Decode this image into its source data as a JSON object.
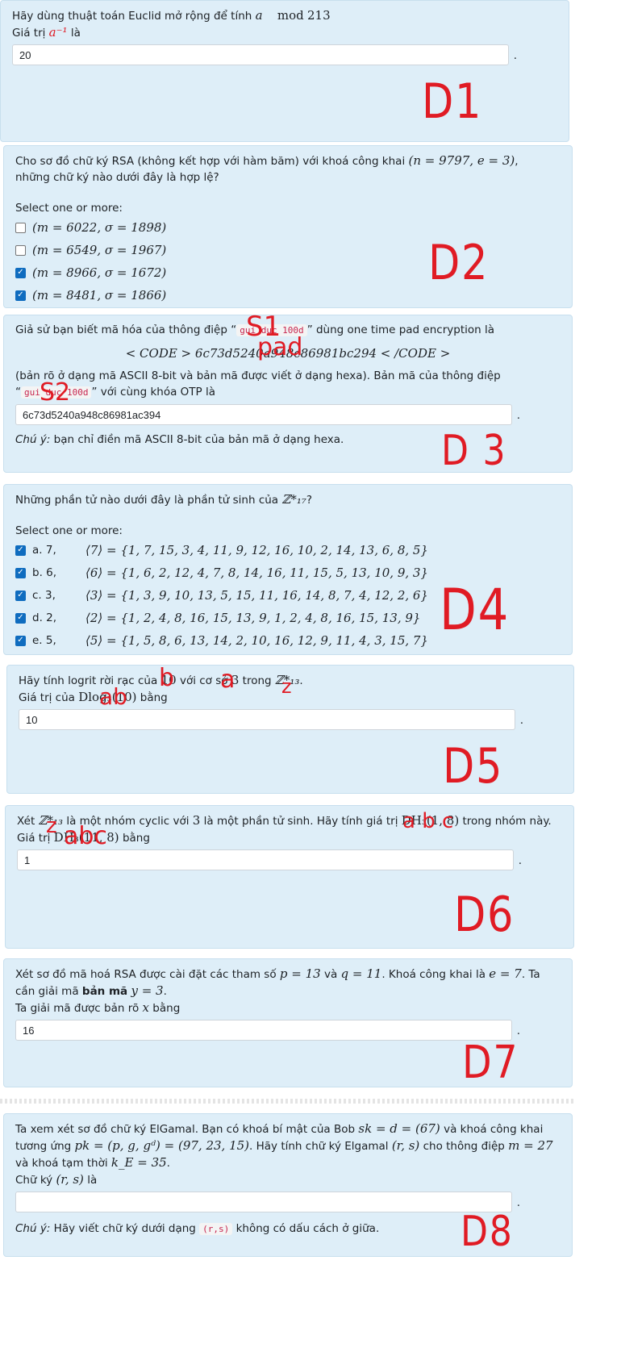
{
  "q1": {
    "text": "Hãy dùng thuật toán Euclid mở rộng để tính",
    "expr": "a",
    "mod": "mod",
    "modval": "213",
    "value_label_pre": "Giá trị",
    "value_label_post": "là",
    "answer": "20",
    "label": "D1",
    "ann_ab": "a⁻¹"
  },
  "q2": {
    "prompt_1": "Cho sơ đồ chữ ký RSA (không kết hợp với hàm băm) với khoá công khai",
    "pubkey": "(n = 9797, e = 3)",
    "prompt_2": "những chữ ký nào dưới đây là hợp lệ?",
    "select": "Select one or more:",
    "options": [
      {
        "label": "(m = 6022, σ = 1898)",
        "checked": false
      },
      {
        "label": "(m = 6549, σ = 1967)",
        "checked": false
      },
      {
        "label": "(m = 8966, σ = 1672)",
        "checked": true
      },
      {
        "label": "(m = 8481, σ = 1866)",
        "checked": true
      }
    ],
    "label": "D2"
  },
  "q3": {
    "prompt_1": "Giả sử bạn biết mã hóa của thông điệp “",
    "msg1": "gui duc 100d",
    "prompt_2": "” dùng one time pad encryption là",
    "code_line": "< CODE > 6c73d5240a948c86981bc294 < /CODE >",
    "prompt_3": "(bản rõ ở dạng mã ASCII 8-bit và bản mã được viết ở dạng hexa). Bản mã của thông điệp",
    "msg2": "gui duc 100d",
    "prompt_4": "” với cùng khóa OTP là",
    "answer": "6c73d5240a948c86981ac394",
    "note_label": "Chú ý:",
    "note": "bạn chỉ điền mã ASCII 8-bit của bản mã ở dạng hexa.",
    "ann_s1": "S1",
    "ann_pad": "pad",
    "ann_s2": "S2",
    "label": "D 3"
  },
  "q4": {
    "prompt": "Những phần tử nào dưới đây là phần tử sinh của",
    "group": "ℤ*₁₇",
    "select": "Select one or more:",
    "options": [
      {
        "letter": "a. 7,",
        "set": "⟨7⟩ = {1, 7, 15, 3, 4, 11, 9, 12, 16, 10, 2, 14, 13, 6, 8, 5}",
        "checked": true
      },
      {
        "letter": "b. 6,",
        "set": "⟨6⟩ = {1, 6, 2, 12, 4, 7, 8, 14, 16, 11, 15, 5, 13, 10, 9, 3}",
        "checked": true
      },
      {
        "letter": "c. 3,",
        "set": "⟨3⟩ = {1, 3, 9, 10, 13, 5, 15, 11, 16, 14, 8, 7, 4, 12, 2, 6}",
        "checked": true
      },
      {
        "letter": "d. 2,",
        "set": "⟨2⟩ = {1, 2, 4, 8, 16, 15, 13, 9, 1, 2, 4, 8, 16, 15, 13, 9}",
        "checked": true
      },
      {
        "letter": "e. 5,",
        "set": "⟨5⟩ = {1, 5, 8, 6, 13, 14, 2, 10, 16, 12, 9, 11, 4, 3, 15, 7}",
        "checked": true
      }
    ],
    "label": "D4"
  },
  "q5": {
    "prompt_1": "Hãy tính logrit rời rạc của",
    "b": "10",
    "prompt_2": "với cơ sở",
    "a": "3",
    "prompt_3": "trong",
    "group": "ℤ*₁₃",
    "value_label_pre": "Giá trị của",
    "dlog": "Dlog₃(10)",
    "value_label_post": "bằng",
    "answer": "10",
    "ann_b": "b",
    "ann_a": "a",
    "ann_z": "z",
    "ann_ab": "ab",
    "label": "D5"
  },
  "q6": {
    "prompt_1": "Xét",
    "group": "ℤ*₁₃",
    "prompt_2": "là một nhóm cyclic với",
    "gen": "3",
    "prompt_3": "là một phần tử sinh. Hãy tính giá trị",
    "dh": "DH₃(1, 8)",
    "prompt_4": "trong nhóm này.",
    "value_label_pre": "Giá trị",
    "dh_value": "DH₃(11, 8)",
    "value_label_post": "bằng",
    "answer": "1",
    "ann_abc1": "a b c",
    "ann_z": "z",
    "ann_abc2": "abc",
    "label": "D6"
  },
  "q7": {
    "prompt_1": "Xét sơ đồ mã hoá RSA được cài đặt các tham số",
    "p": "p = 13",
    "and": "và",
    "q": "q = 11",
    "prompt_2": ". Khoá công khai là",
    "e": "e = 7",
    "prompt_3": ". Ta",
    "prompt_4": "cần giải mã",
    "bold": "bản mã",
    "y": "y = 3",
    "value_label_pre": "Ta giải mã được bản rõ",
    "x": "x",
    "value_label_post": "bằng",
    "answer": "16",
    "label": "D7"
  },
  "q8": {
    "prompt_1": "Ta xem xét sơ đồ chữ ký ElGamal. Bạn có khoá bí mật của Bob",
    "sk": "sk = d = (67)",
    "prompt_2": "và khoá công khai",
    "prompt_3": "tương ứng",
    "pk": "pk = (p, g, gᵈ) = (97, 23, 15)",
    "prompt_4": ". Hãy tính chữ ký Elgamal",
    "rs": "(r, s)",
    "prompt_5": "cho thông điệp",
    "m": "m = 27",
    "prompt_6": "và khoá tạm thời",
    "ke": "k_E = 35",
    "value_label_pre": "Chữ ký",
    "value_label_post": "là",
    "answer": "",
    "note_label": "Chú ý:",
    "note_1": "Hãy viết chữ ký dưới dạng",
    "note_code": "(r,s)",
    "note_2": "không có dấu cách ở giữa.",
    "label": "D8"
  }
}
